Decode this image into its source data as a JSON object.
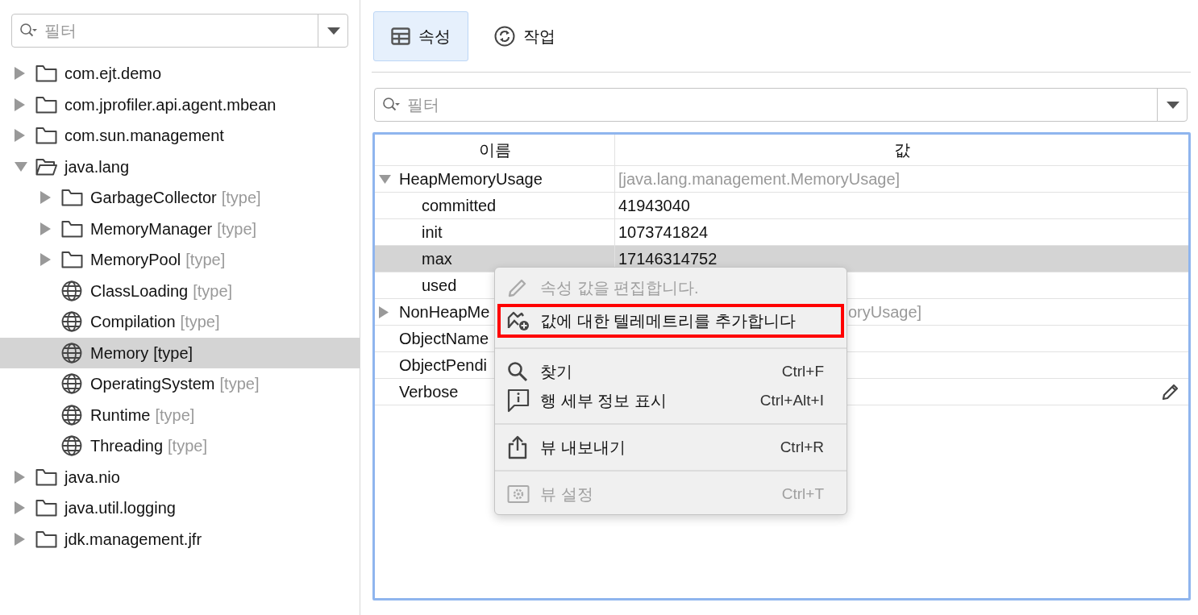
{
  "left_filter": {
    "placeholder": "필터"
  },
  "tree": [
    {
      "label": "com.ejt.demo",
      "kind": "folder",
      "expanded": false,
      "selected": false
    },
    {
      "label": "com.jprofiler.api.agent.mbean",
      "kind": "folder",
      "expanded": false,
      "selected": false
    },
    {
      "label": "com.sun.management",
      "kind": "folder",
      "expanded": false,
      "selected": false
    },
    {
      "label": "java.lang",
      "kind": "folder",
      "expanded": true,
      "selected": false,
      "children": [
        {
          "label": "GarbageCollector",
          "suffix": "[type]",
          "kind": "folder",
          "expanded": false,
          "selected": false
        },
        {
          "label": "MemoryManager",
          "suffix": "[type]",
          "kind": "folder",
          "expanded": false,
          "selected": false
        },
        {
          "label": "MemoryPool",
          "suffix": "[type]",
          "kind": "folder",
          "expanded": false,
          "selected": false
        },
        {
          "label": "ClassLoading",
          "suffix": "[type]",
          "kind": "object",
          "selected": false
        },
        {
          "label": "Compilation",
          "suffix": "[type]",
          "kind": "object",
          "selected": false
        },
        {
          "label": "Memory",
          "suffix": "[type]",
          "kind": "object",
          "selected": true
        },
        {
          "label": "OperatingSystem",
          "suffix": "[type]",
          "kind": "object",
          "selected": false
        },
        {
          "label": "Runtime",
          "suffix": "[type]",
          "kind": "object",
          "selected": false
        },
        {
          "label": "Threading",
          "suffix": "[type]",
          "kind": "object",
          "selected": false
        }
      ]
    },
    {
      "label": "java.nio",
      "kind": "folder",
      "expanded": false,
      "selected": false
    },
    {
      "label": "java.util.logging",
      "kind": "folder",
      "expanded": false,
      "selected": false
    },
    {
      "label": "jdk.management.jfr",
      "kind": "folder",
      "expanded": false,
      "selected": false
    }
  ],
  "tabs": [
    {
      "label": "속성",
      "selected": true
    },
    {
      "label": "작업",
      "selected": false
    }
  ],
  "right_filter": {
    "placeholder": "필터"
  },
  "table": {
    "columns": [
      "이름",
      "값"
    ],
    "rows": [
      {
        "name": "HeapMemoryUsage",
        "value": "[java.lang.management.MemoryUsage]",
        "kind": "composite",
        "expanded": true,
        "selected": false,
        "children": [
          {
            "name": "committed",
            "value": "41943040",
            "kind": "simple",
            "selected": false
          },
          {
            "name": "init",
            "value": "1073741824",
            "kind": "simple",
            "selected": false
          },
          {
            "name": "max",
            "value": "17146314752",
            "kind": "simple",
            "selected": true
          },
          {
            "name": "used",
            "selected": false
          }
        ]
      },
      {
        "name": "NonHeapMe",
        "value": "oryUsage]",
        "kind": "composite",
        "expanded": false,
        "selected": false
      },
      {
        "name": "ObjectName",
        "selected": false
      },
      {
        "name": "ObjectPendi",
        "selected": false
      },
      {
        "name": "Verbose",
        "editable": true,
        "selected": false
      }
    ]
  },
  "context_menu": [
    {
      "kind": "item",
      "label": "속성 값을 편집합니다.",
      "disabled": true,
      "outlined": false
    },
    {
      "kind": "item",
      "label": "값에 대한 텔레메트리를 추가합니다",
      "disabled": false,
      "outlined": true
    },
    {
      "kind": "separator"
    },
    {
      "kind": "item",
      "label": "찾기",
      "shortcut": "Ctrl+F",
      "disabled": false,
      "outlined": false
    },
    {
      "kind": "item",
      "label": "행 세부 정보 표시",
      "shortcut": "Ctrl+Alt+I",
      "disabled": false,
      "outlined": false
    },
    {
      "kind": "separator"
    },
    {
      "kind": "item",
      "label": "뷰 내보내기",
      "shortcut": "Ctrl+R",
      "disabled": false,
      "outlined": false
    },
    {
      "kind": "separator"
    },
    {
      "kind": "item",
      "label": "뷰 설정",
      "shortcut": "Ctrl+T",
      "disabled": true,
      "outlined": false
    }
  ]
}
